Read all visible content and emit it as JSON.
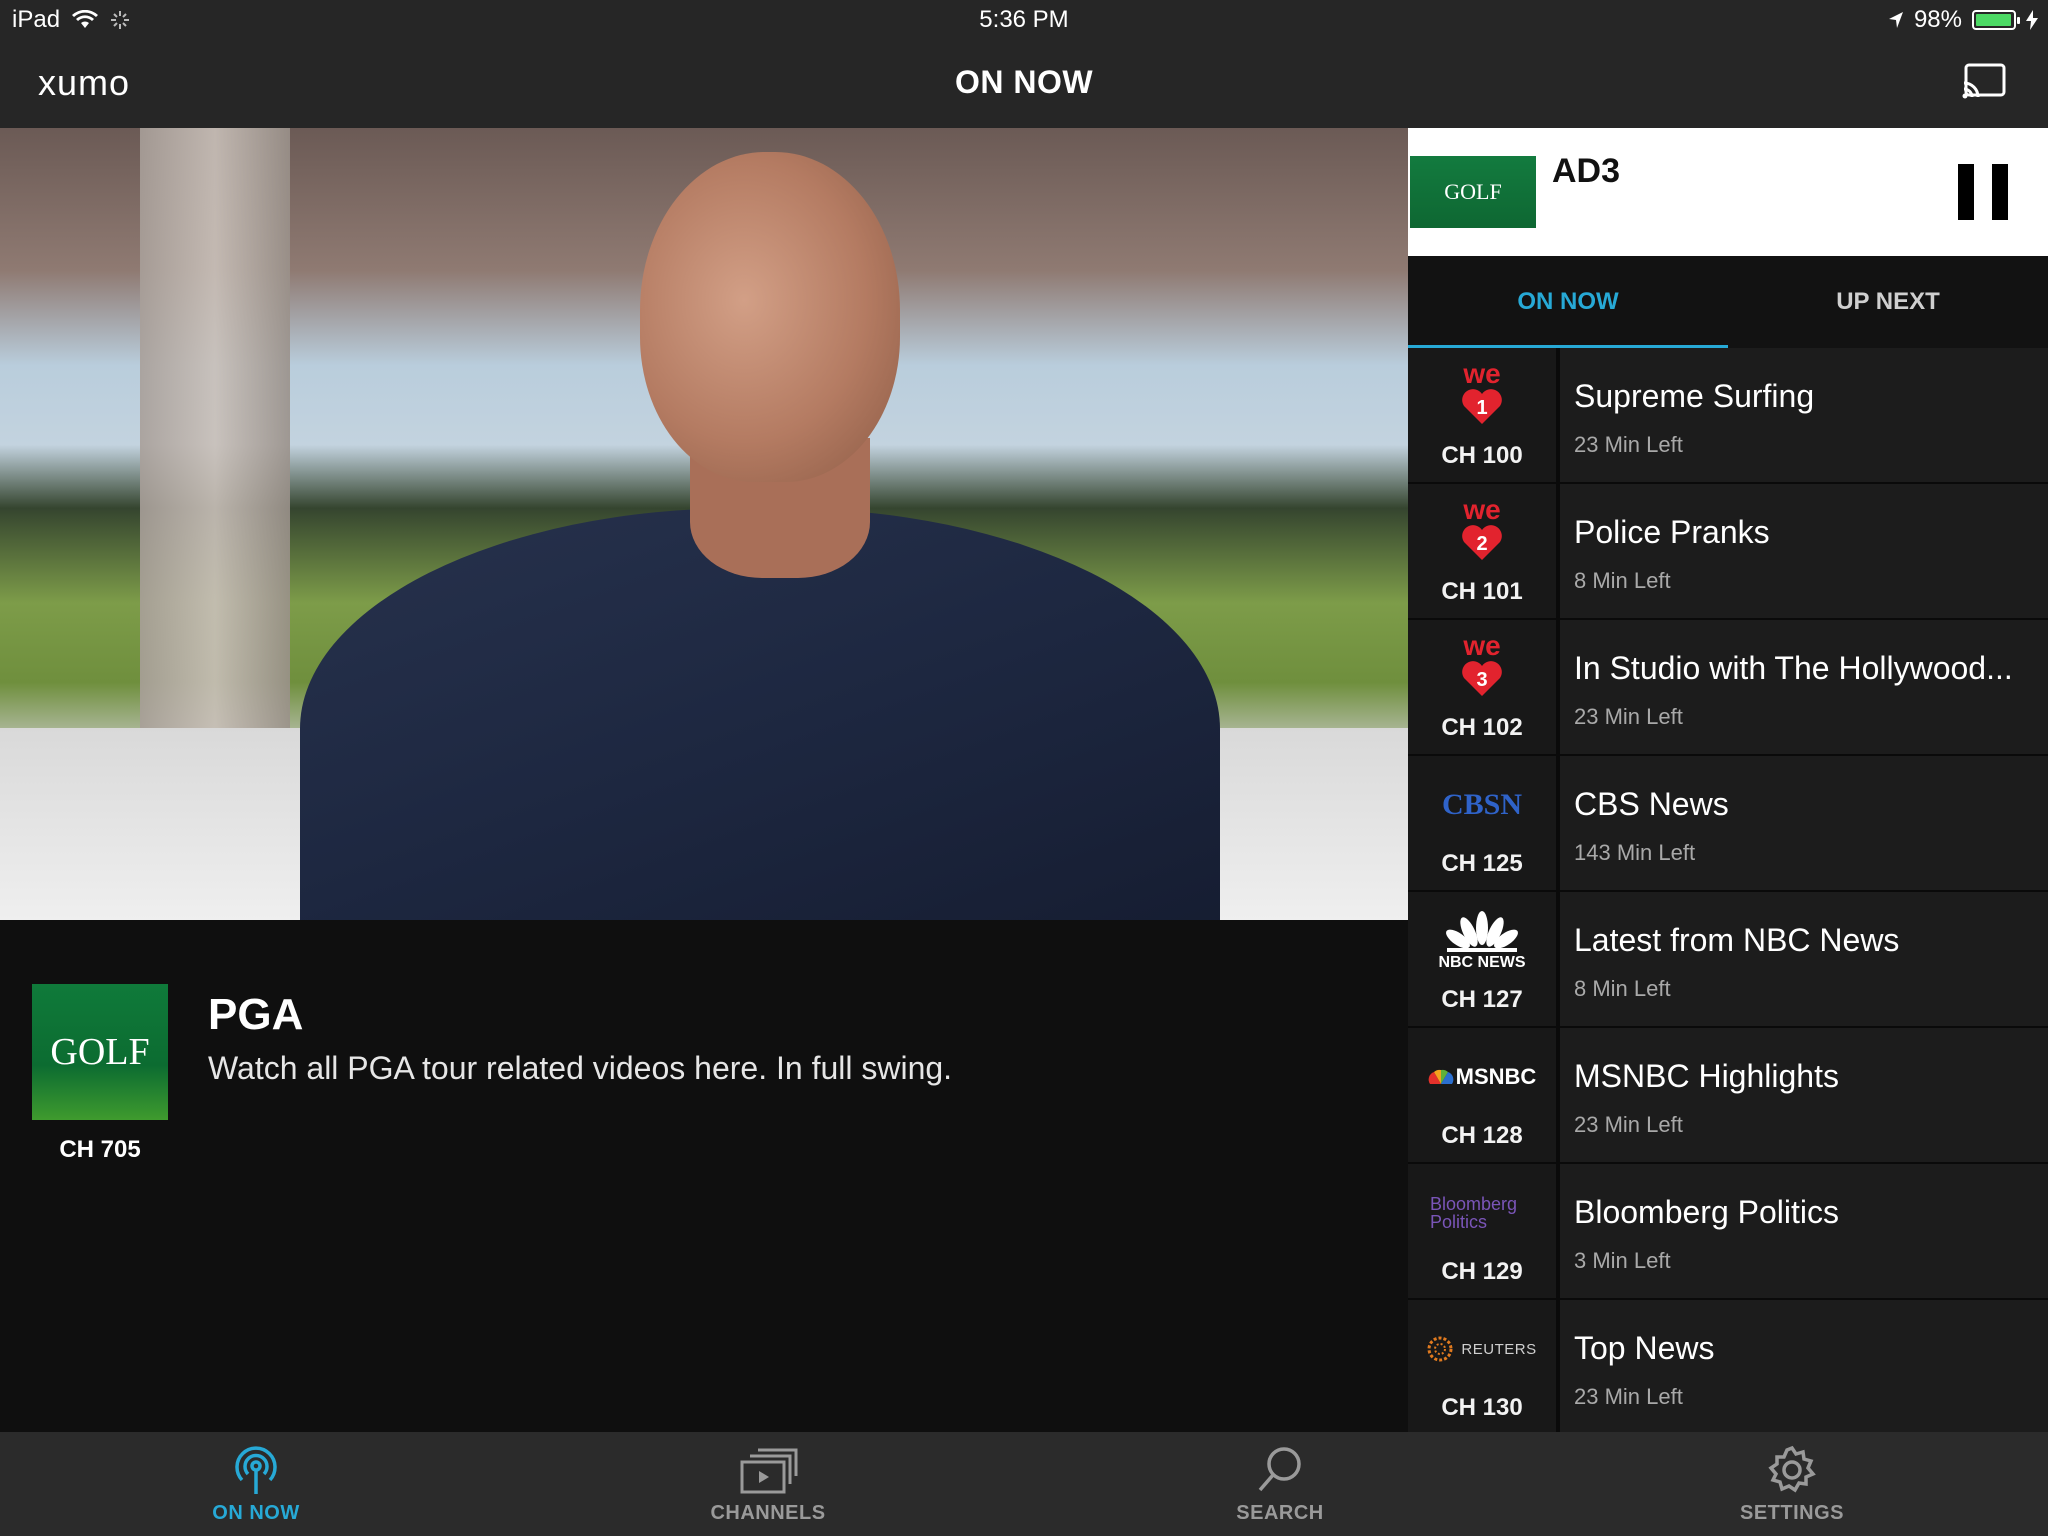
{
  "status": {
    "device": "iPad",
    "time": "5:36 PM",
    "battery": "98%",
    "battery_level": 0.98
  },
  "header": {
    "logo": "xumo",
    "title": "ON NOW"
  },
  "player": {
    "channel_logo": "GOLF",
    "channel": "CH 705",
    "title": "PGA",
    "description": "Watch all PGA tour related videos here. In full swing."
  },
  "ad": {
    "logo": "GOLF",
    "label": "AD3"
  },
  "tabs": {
    "on_now": "ON NOW",
    "up_next": "UP NEXT"
  },
  "channels": [
    {
      "logo": "we",
      "logo_num": "1",
      "channel": "CH 100",
      "title": "Supreme Surfing",
      "time_left": "23 Min Left"
    },
    {
      "logo": "we",
      "logo_num": "2",
      "channel": "CH 101",
      "title": "Police Pranks",
      "time_left": "8 Min Left"
    },
    {
      "logo": "we",
      "logo_num": "3",
      "channel": "CH 102",
      "title": "In Studio with The Hollywood...",
      "time_left": "23 Min Left"
    },
    {
      "logo": "CBSN",
      "channel": "CH 125",
      "title": "CBS News",
      "time_left": "143 Min Left"
    },
    {
      "logo": "NBC NEWS",
      "channel": "CH 127",
      "title": "Latest from NBC News",
      "time_left": "8 Min Left"
    },
    {
      "logo": "MSNBC",
      "channel": "CH 128",
      "title": "MSNBC Highlights",
      "time_left": "23 Min Left"
    },
    {
      "logo": "Bloomberg Politics",
      "channel": "CH 129",
      "title": "Bloomberg Politics",
      "time_left": "3 Min Left"
    },
    {
      "logo": "REUTERS",
      "channel": "CH 130",
      "title": "Top News",
      "time_left": "23 Min Left"
    }
  ],
  "bottom_nav": [
    {
      "label": "ON NOW",
      "icon": "broadcast-icon",
      "active": true
    },
    {
      "label": "CHANNELS",
      "icon": "channels-icon",
      "active": false
    },
    {
      "label": "SEARCH",
      "icon": "search-icon",
      "active": false
    },
    {
      "label": "SETTINGS",
      "icon": "gear-icon",
      "active": false
    }
  ],
  "colors": {
    "accent": "#27a9d6",
    "we_red": "#e2232e",
    "golf_green": "#0f7a3a"
  }
}
